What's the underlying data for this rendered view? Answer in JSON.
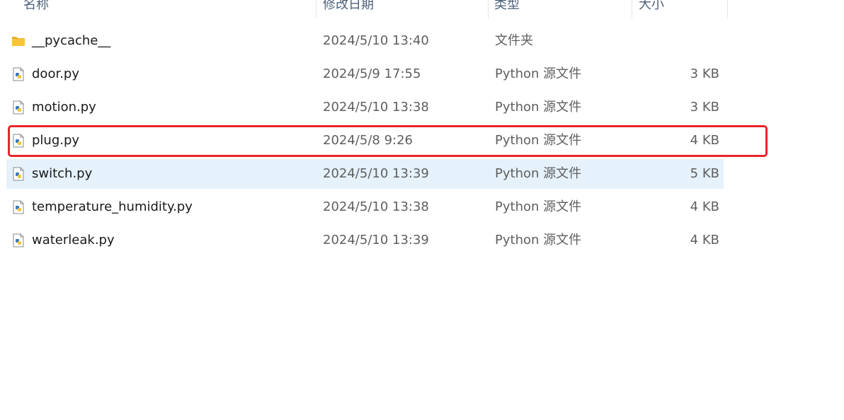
{
  "columns": {
    "name": "名称",
    "date": "修改日期",
    "type": "类型",
    "size": "大小"
  },
  "files": [
    {
      "name": "__pycache__",
      "date": "2024/5/10 13:40",
      "type": "文件夹",
      "size": "",
      "icon": "folder-icon"
    },
    {
      "name": "door.py",
      "date": "2024/5/9 17:55",
      "type": "Python 源文件",
      "size": "3 KB",
      "icon": "python-file-icon"
    },
    {
      "name": "motion.py",
      "date": "2024/5/10 13:38",
      "type": "Python 源文件",
      "size": "3 KB",
      "icon": "python-file-icon"
    },
    {
      "name": "plug.py",
      "date": "2024/5/8 9:26",
      "type": "Python 源文件",
      "size": "4 KB",
      "icon": "python-file-icon"
    },
    {
      "name": "switch.py",
      "date": "2024/5/10 13:39",
      "type": "Python 源文件",
      "size": "5 KB",
      "icon": "python-file-icon"
    },
    {
      "name": "temperature_humidity.py",
      "date": "2024/5/10 13:38",
      "type": "Python 源文件",
      "size": "4 KB",
      "icon": "python-file-icon"
    },
    {
      "name": "waterleak.py",
      "date": "2024/5/10 13:39",
      "type": "Python 源文件",
      "size": "4 KB",
      "icon": "python-file-icon"
    }
  ],
  "selected_file": "switch.py",
  "highlighted_file": "plug.py",
  "colors": {
    "selection": "#e5f1fb",
    "highlight_border": "#e8262a",
    "folder": "#f8c53a",
    "python_blue": "#3b78b4",
    "python_yellow": "#f2c83a"
  }
}
